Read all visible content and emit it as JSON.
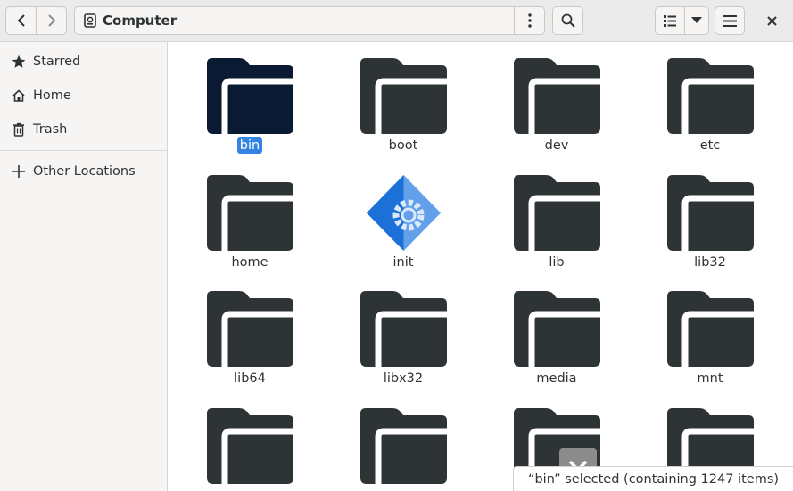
{
  "header": {
    "location": "Computer",
    "icons": {
      "back": "chevron-left-icon",
      "forward": "chevron-right-icon",
      "drive": "drive-icon",
      "path_menu": "vertical-dots-icon",
      "search": "search-icon",
      "list_view": "list-view-icon",
      "view_options": "chevron-down-icon",
      "main_menu": "hamburger-icon",
      "close": "close-icon"
    }
  },
  "sidebar": {
    "items": [
      {
        "label": "Starred",
        "icon": "star-icon"
      },
      {
        "label": "Home",
        "icon": "home-icon"
      },
      {
        "label": "Trash",
        "icon": "trash-icon"
      },
      {
        "label": "Other Locations",
        "icon": "plus-icon"
      }
    ]
  },
  "files": [
    {
      "name": "bin",
      "type": "folder",
      "selected": true
    },
    {
      "name": "boot",
      "type": "folder"
    },
    {
      "name": "dev",
      "type": "folder"
    },
    {
      "name": "etc",
      "type": "folder"
    },
    {
      "name": "home",
      "type": "folder"
    },
    {
      "name": "init",
      "type": "executable"
    },
    {
      "name": "lib",
      "type": "folder"
    },
    {
      "name": "lib32",
      "type": "folder"
    },
    {
      "name": "lib64",
      "type": "folder"
    },
    {
      "name": "libx32",
      "type": "folder"
    },
    {
      "name": "media",
      "type": "folder"
    },
    {
      "name": "mnt",
      "type": "folder"
    },
    {
      "name": "",
      "type": "folder"
    },
    {
      "name": "",
      "type": "folder"
    },
    {
      "name": "",
      "type": "folder"
    },
    {
      "name": "",
      "type": "folder"
    }
  ],
  "status": {
    "text": "“bin” selected (containing 1247 items)"
  },
  "colors": {
    "folder": "#2e3436",
    "folder_selected": "#0b1a33",
    "selection": "#3584e4",
    "exec_light": "#62a0ea",
    "exec_dark": "#1c71d8"
  }
}
